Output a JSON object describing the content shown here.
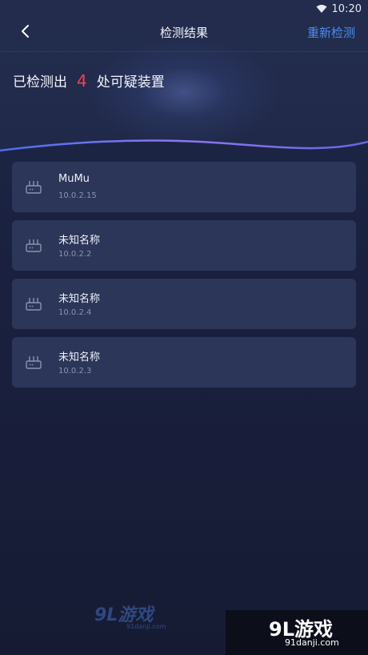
{
  "status_bar": {
    "time": "10:20"
  },
  "nav": {
    "title": "检测结果",
    "rescan_label": "重新检测"
  },
  "summary": {
    "prefix": "已检测出",
    "count": "4",
    "suffix": "处可疑装置"
  },
  "devices": [
    {
      "name": "MuMu",
      "ip": "10.0.2.15"
    },
    {
      "name": "未知名称",
      "ip": "10.0.2.2"
    },
    {
      "name": "未知名称",
      "ip": "10.0.2.4"
    },
    {
      "name": "未知名称",
      "ip": "10.0.2.3"
    }
  ],
  "watermark": {
    "center_logo": "9L游戏",
    "center_site": "91danji.com",
    "corner_logo": "9L游戏",
    "corner_site": "91danji.com"
  },
  "colors": {
    "accent": "#4a8df5",
    "count": "#f2424f",
    "card": "#2c3659",
    "wave": "#7c6cf0"
  },
  "icons": {
    "back": "chevron-left-icon",
    "wifi": "wifi-icon",
    "device": "router-icon"
  }
}
